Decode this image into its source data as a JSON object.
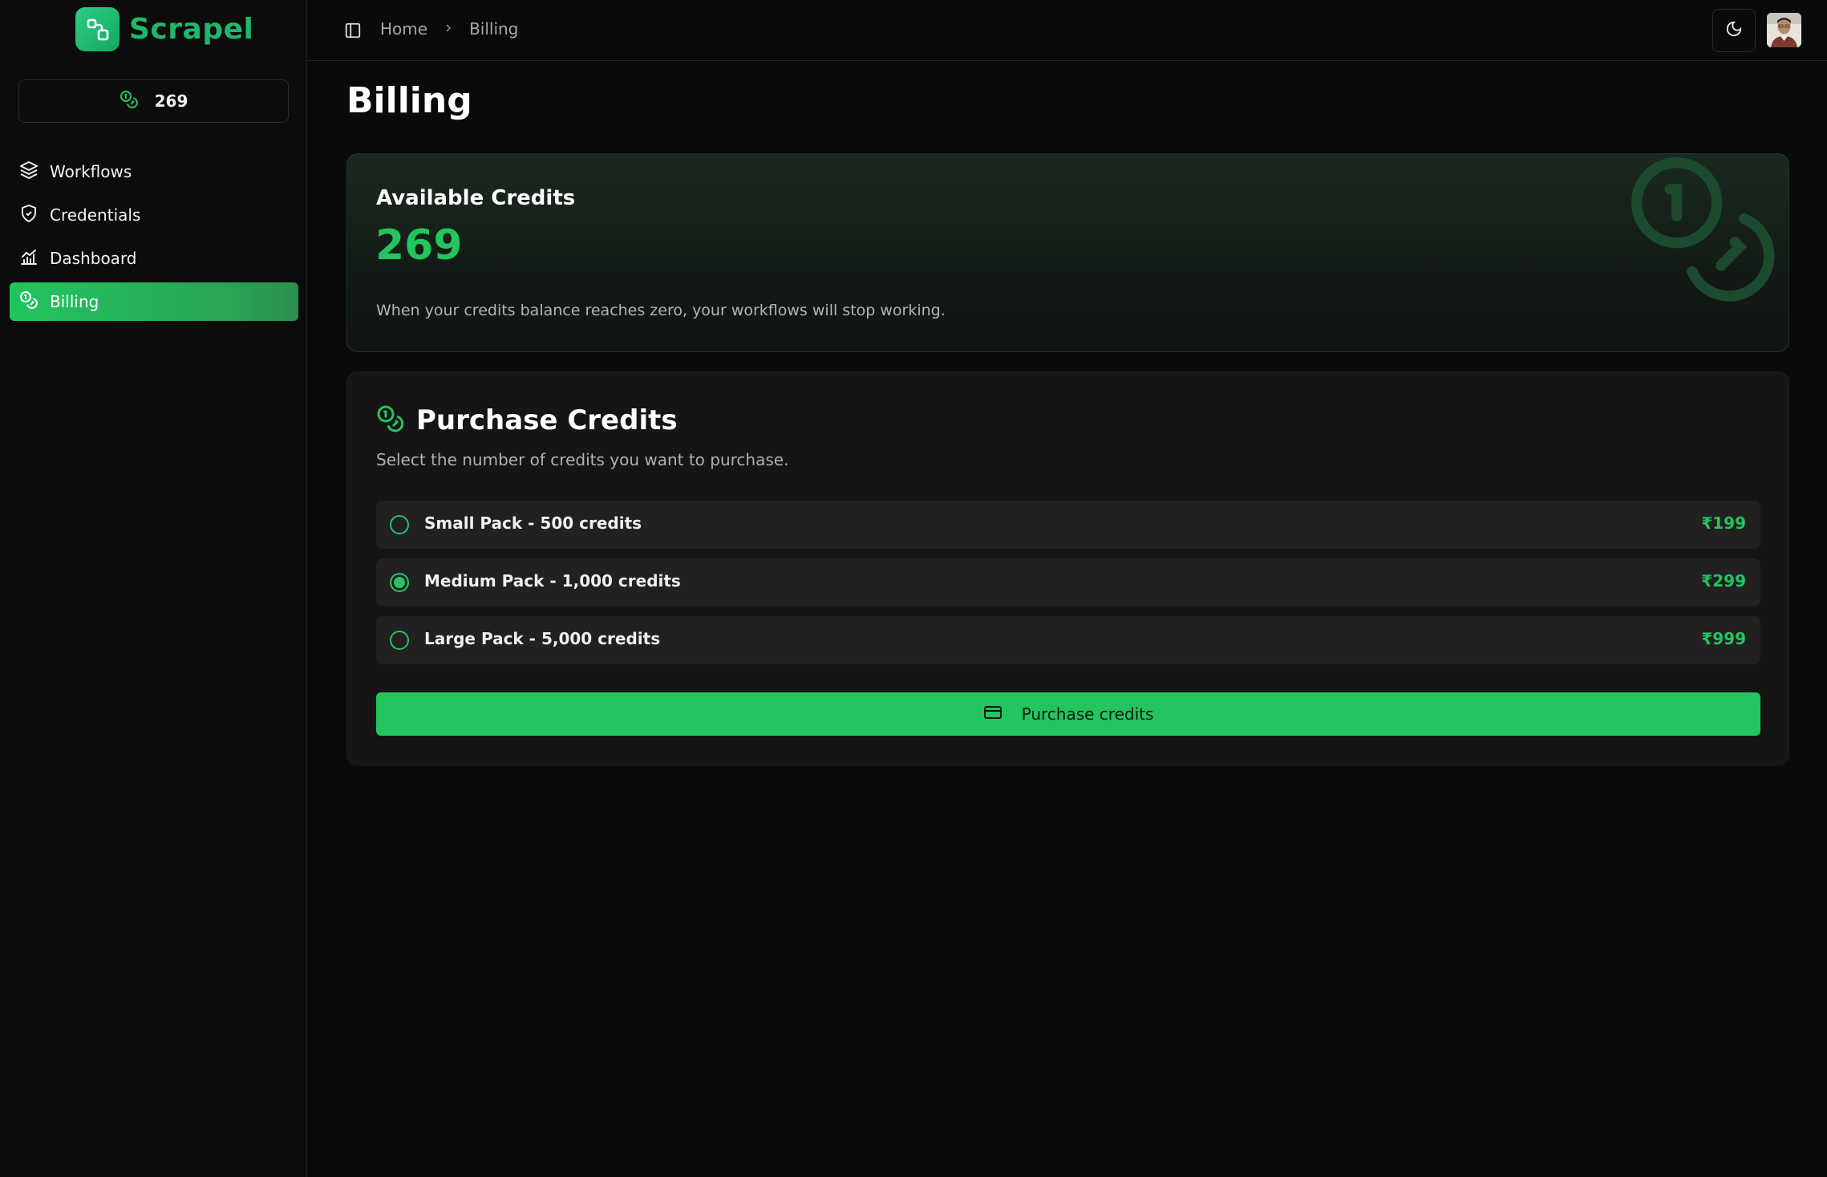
{
  "brand": {
    "name": "Scrapel",
    "accent": "#22c55e"
  },
  "sidebar": {
    "credits_count": "269",
    "items": [
      {
        "label": "Workflows",
        "icon": "layers-icon",
        "active": false
      },
      {
        "label": "Credentials",
        "icon": "shield-check-icon",
        "active": false
      },
      {
        "label": "Dashboard",
        "icon": "chart-icon",
        "active": false
      },
      {
        "label": "Billing",
        "icon": "coins-icon",
        "active": true
      }
    ]
  },
  "header": {
    "breadcrumb": [
      "Home",
      "Billing"
    ],
    "theme_icon": "moon-icon"
  },
  "page": {
    "title": "Billing"
  },
  "available": {
    "label": "Available Credits",
    "amount": "269",
    "note": "When your credits balance reaches zero, your workflows will stop working."
  },
  "purchase": {
    "title": "Purchase Credits",
    "subtitle": "Select the number of credits you want to purchase.",
    "options": [
      {
        "label": "Small Pack - 500 credits",
        "price": "₹199",
        "selected": false
      },
      {
        "label": "Medium Pack - 1,000 credits",
        "price": "₹299",
        "selected": true
      },
      {
        "label": "Large Pack - 5,000 credits",
        "price": "₹999",
        "selected": false
      }
    ],
    "button_label": "Purchase credits"
  }
}
